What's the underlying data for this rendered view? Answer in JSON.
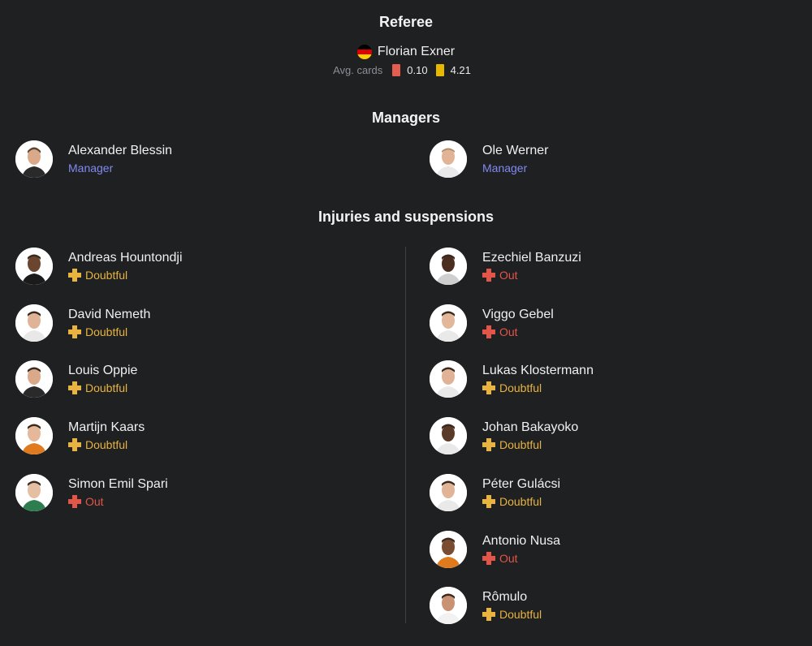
{
  "referee": {
    "title": "Referee",
    "name": "Florian Exner",
    "flag_colors": [
      "#000000",
      "#dd0000",
      "#ffce00"
    ],
    "avg_label": "Avg. cards",
    "red_avg": "0.10",
    "yellow_avg": "4.21"
  },
  "managers": {
    "title": "Managers",
    "home": {
      "name": "Alexander Blessin",
      "role": "Manager"
    },
    "away": {
      "name": "Ole Werner",
      "role": "Manager"
    }
  },
  "injuries": {
    "title": "Injuries and suspensions",
    "home": [
      {
        "name": "Andreas Hountondji",
        "status": "Doubtful"
      },
      {
        "name": "David Nemeth",
        "status": "Doubtful"
      },
      {
        "name": "Louis Oppie",
        "status": "Doubtful"
      },
      {
        "name": "Martijn Kaars",
        "status": "Doubtful"
      },
      {
        "name": "Simon Emil Spari",
        "status": "Out"
      }
    ],
    "away": [
      {
        "name": "Ezechiel Banzuzi",
        "status": "Out"
      },
      {
        "name": "Viggo Gebel",
        "status": "Out"
      },
      {
        "name": "Lukas Klostermann",
        "status": "Doubtful"
      },
      {
        "name": "Johan Bakayoko",
        "status": "Doubtful"
      },
      {
        "name": "Péter Gulácsi",
        "status": "Doubtful"
      },
      {
        "name": "Antonio Nusa",
        "status": "Out"
      },
      {
        "name": "Rômulo",
        "status": "Doubtful"
      }
    ]
  },
  "colors": {
    "background": "#1e2022",
    "manager_role": "#8289f0",
    "doubtful": "#e8b33f",
    "out": "#e25549",
    "red_card": "#e35d50",
    "yellow_card": "#e6b800"
  }
}
